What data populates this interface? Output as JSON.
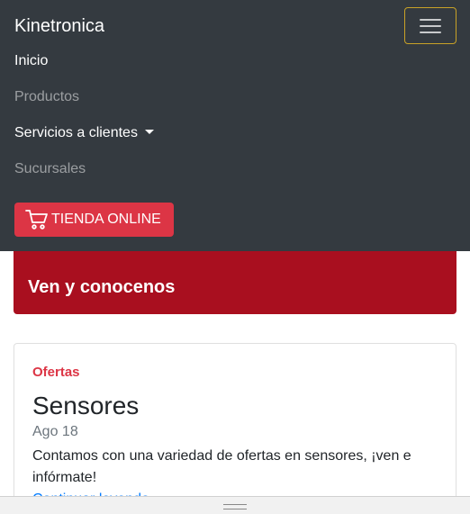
{
  "navbar": {
    "brand": "Kinetronica",
    "toggler_icon": "hamburger-menu-icon",
    "items": [
      {
        "label": "Inicio",
        "active": true
      },
      {
        "label": "Productos",
        "active": false
      },
      {
        "label": "Servicios a clientes",
        "active": true,
        "dropdown": true
      },
      {
        "label": "Sucursales",
        "active": false
      }
    ],
    "store_button": {
      "label": "TIENDA ONLINE",
      "icon": "shopping-cart-icon"
    }
  },
  "banner": {
    "title": "Ven y conocenos"
  },
  "card": {
    "tag": "Ofertas",
    "title": "Sensores",
    "date": "Ago 18",
    "text": "Contamos con una variedad de ofertas en sensores, ¡ven e infórmate!",
    "link": "Continuar leyendo"
  },
  "colors": {
    "navbar_bg": "#343a40",
    "accent_red": "#dc3545",
    "banner_red": "#a90f1f",
    "link_blue": "#007bff",
    "toggler_border": "#c9a227"
  }
}
